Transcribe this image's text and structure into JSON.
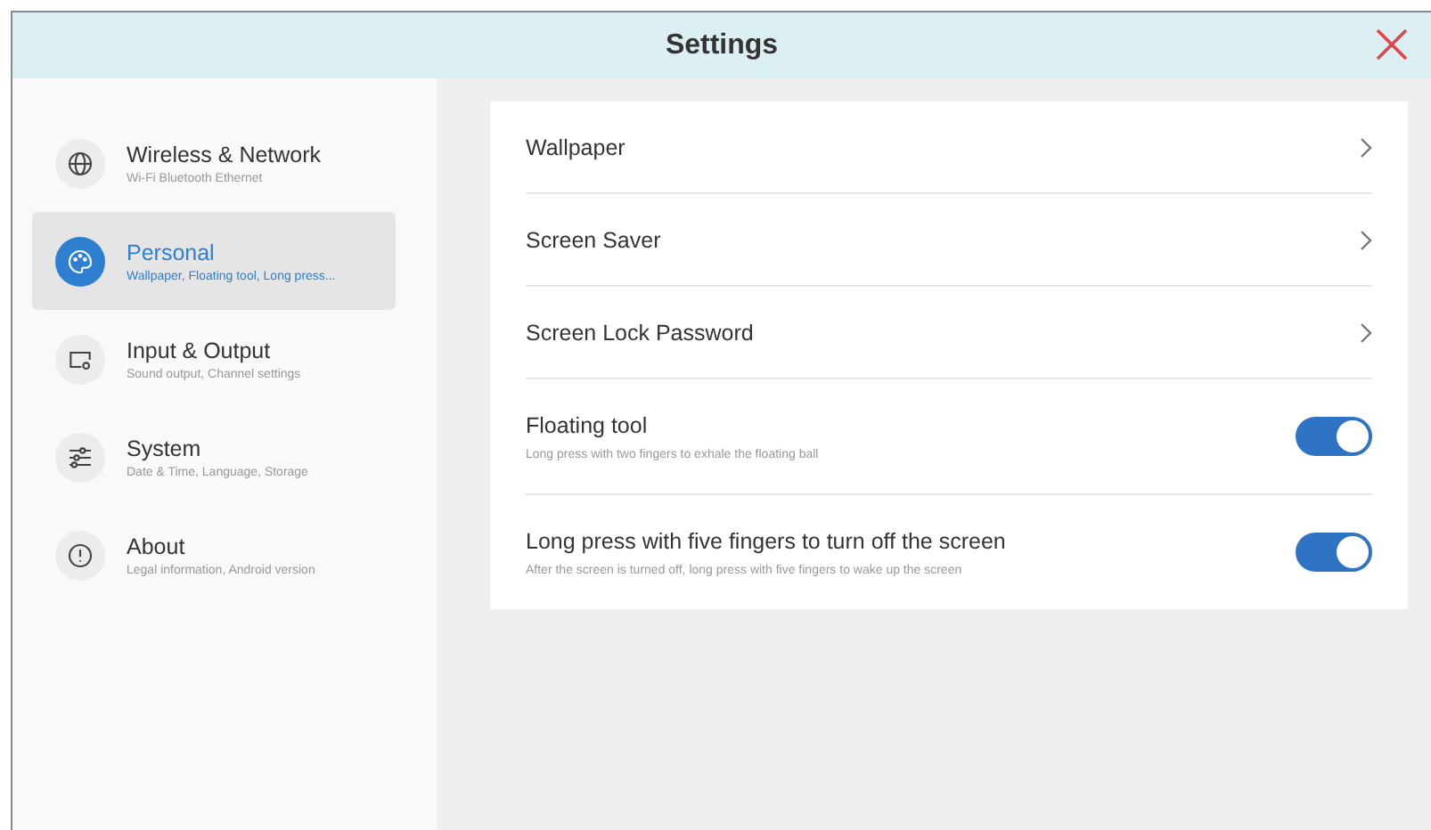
{
  "window": {
    "title": "Settings"
  },
  "sidebar": {
    "items": [
      {
        "kind": "globe",
        "title": "Wireless & Network",
        "subtitle": "Wi-Fi Bluetooth Ethernet",
        "selected": false
      },
      {
        "kind": "palette",
        "title": "Personal",
        "subtitle": "Wallpaper, Floating tool, Long press...",
        "selected": true
      },
      {
        "kind": "display",
        "title": "Input & Output",
        "subtitle": "Sound output, Channel settings",
        "selected": false
      },
      {
        "kind": "sliders",
        "title": "System",
        "subtitle": "Date & Time, Language, Storage",
        "selected": false
      },
      {
        "kind": "info",
        "title": "About",
        "subtitle": "Legal information, Android version",
        "selected": false
      }
    ]
  },
  "settings": [
    {
      "kind": "link",
      "title": "Wallpaper"
    },
    {
      "kind": "link",
      "title": "Screen Saver"
    },
    {
      "kind": "link",
      "title": "Screen Lock Password"
    },
    {
      "kind": "toggle",
      "title": "Floating tool",
      "subtitle": "Long press with two fingers to exhale the floating ball",
      "on": true
    },
    {
      "kind": "toggle",
      "title": "Long press with five fingers to turn off the screen",
      "subtitle": "After the screen is turned off, long press with five fingers to wake up the screen",
      "on": true
    }
  ]
}
